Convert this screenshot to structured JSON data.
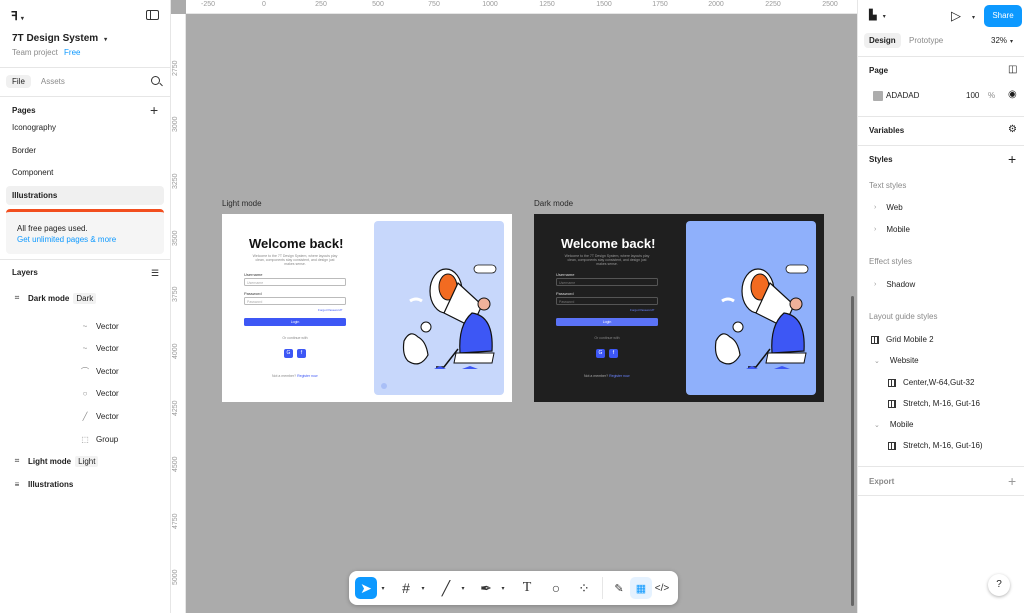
{
  "left_panel": {
    "project_title": "7T Design System",
    "project_team": "Team project",
    "plan_badge": "Free",
    "tabs": {
      "file": "File",
      "assets": "Assets"
    },
    "pages_header": "Pages",
    "pages": [
      "Iconography",
      "Border",
      "Component",
      "Illustrations"
    ],
    "notice_title": "All free pages used.",
    "notice_link": "Get unlimited pages & more",
    "layers_header": "Layers",
    "layers": [
      {
        "name": "Dark mode",
        "tag": "Dark"
      },
      {
        "name": "Vector"
      },
      {
        "name": "Vector"
      },
      {
        "name": "Vector"
      },
      {
        "name": "Vector"
      },
      {
        "name": "Vector"
      },
      {
        "name": "Group"
      },
      {
        "name": "Light mode",
        "tag": "Light"
      },
      {
        "name": "Illustrations"
      }
    ]
  },
  "ruler": {
    "top": [
      "-250",
      "0",
      "250",
      "500",
      "750",
      "1000",
      "1250",
      "1500",
      "1750",
      "2000",
      "2250",
      "2500"
    ],
    "left": [
      "2750",
      "3000",
      "3250",
      "3500",
      "3750",
      "4000",
      "4250",
      "4500",
      "4750",
      "5000"
    ]
  },
  "canvas": {
    "background": "#ABABAB",
    "light_frame": {
      "label": "Light mode",
      "welcome": "Welcome back!",
      "subtitle": "Welcome to the 7T Design System, where layouts play clean, components stay consistent, and design just makes sense.",
      "username_label": "Username",
      "username_placeholder": "Username",
      "password_label": "Password",
      "password_placeholder": "Password",
      "forgot": "Forgot Password?",
      "login": "Login",
      "or_continue": "Or continue with",
      "social": [
        "G",
        "f"
      ],
      "not_member": "Not a member?",
      "register": "Register now"
    },
    "dark_frame": {
      "label": "Dark mode",
      "welcome": "Welcome back!",
      "subtitle": "Welcome to the 7T Design System, where layouts play clean, components stay consistent, and design just makes sense.",
      "username_label": "Username",
      "username_placeholder": "Username",
      "password_label": "Password",
      "password_placeholder": "Password",
      "forgot": "Forgot Password?",
      "login": "Login",
      "or_continue": "Or continue with",
      "social": [
        "G",
        "f"
      ],
      "not_member": "Not a member?",
      "register": "Register now"
    }
  },
  "right_panel": {
    "share": "Share",
    "tabs": {
      "design": "Design",
      "prototype": "Prototype"
    },
    "zoom": "32%",
    "page_header": "Page",
    "page_color": "ADADAD",
    "page_opacity": "100",
    "page_opacity_unit": "%",
    "variables": "Variables",
    "styles": "Styles",
    "text_styles_label": "Text styles",
    "text_styles": [
      "Web",
      "Mobile"
    ],
    "effect_styles_label": "Effect styles",
    "effect_styles": [
      "Shadow"
    ],
    "layout_guide_label": "Layout guide styles",
    "layout_guides": {
      "top": "Grid Mobile 2",
      "website_group": "Website",
      "website_items": [
        "Center,W-64,Gut-32",
        "Stretch, M-16, Gut-16"
      ],
      "mobile_group": "Mobile",
      "mobile_items": [
        "Stretch, M-16, Gut-16)"
      ]
    },
    "export": "Export",
    "help": "?"
  },
  "colors": {
    "accent": "#0D99FF",
    "notice_bar": "#F24E1E",
    "brand_blue": "#3D57F5"
  },
  "icons": [
    "figma-menu-icon",
    "sidebar-toggle-icon",
    "search-icon",
    "plus-icon",
    "layers-list-icon",
    "frame-icon",
    "play-icon",
    "eye-icon",
    "styles-icon",
    "variables-icon",
    "move-tool-icon",
    "frame-tool-icon",
    "line-tool-icon",
    "pen-tool-icon",
    "text-tool-icon",
    "comment-tool-icon",
    "components-icon",
    "draw-mode-icon",
    "design-mode-icon",
    "dev-mode-icon"
  ]
}
